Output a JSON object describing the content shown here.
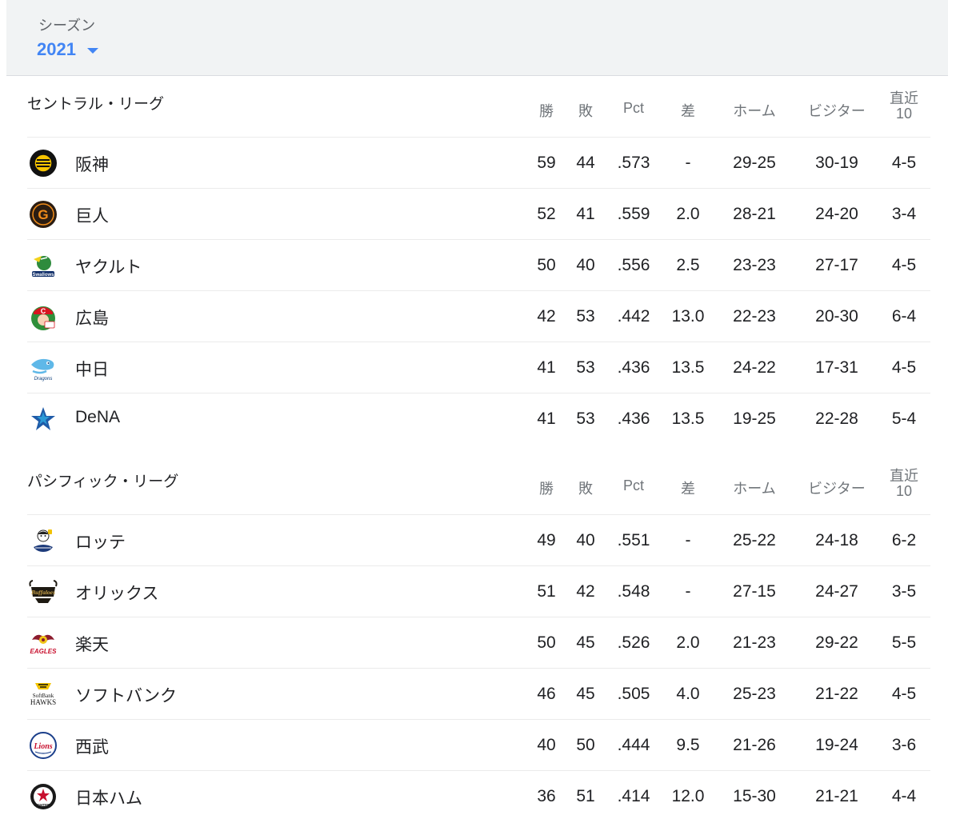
{
  "season": {
    "label": "シーズン",
    "value": "2021"
  },
  "columns": {
    "wins": "勝",
    "losses": "敗",
    "pct": "Pct",
    "gb": "差",
    "home": "ホーム",
    "visitor": "ビジター",
    "last10_line1": "直近",
    "last10_line2": "10"
  },
  "leagues": [
    {
      "name": "セントラル・リーグ",
      "teams": [
        {
          "name": "阪神",
          "logo": "tigers-logo",
          "w": "59",
          "l": "44",
          "pct": ".573",
          "gb": "-",
          "home": "29-25",
          "away": "30-19",
          "last10": "4-5"
        },
        {
          "name": "巨人",
          "logo": "giants-logo",
          "w": "52",
          "l": "41",
          "pct": ".559",
          "gb": "2.0",
          "home": "28-21",
          "away": "24-20",
          "last10": "3-4"
        },
        {
          "name": "ヤクルト",
          "logo": "swallows-logo",
          "w": "50",
          "l": "40",
          "pct": ".556",
          "gb": "2.5",
          "home": "23-23",
          "away": "27-17",
          "last10": "4-5"
        },
        {
          "name": "広島",
          "logo": "carp-logo",
          "w": "42",
          "l": "53",
          "pct": ".442",
          "gb": "13.0",
          "home": "22-23",
          "away": "20-30",
          "last10": "6-4"
        },
        {
          "name": "中日",
          "logo": "dragons-logo",
          "w": "41",
          "l": "53",
          "pct": ".436",
          "gb": "13.5",
          "home": "24-22",
          "away": "17-31",
          "last10": "4-5"
        },
        {
          "name": "DeNA",
          "logo": "baystars-logo",
          "w": "41",
          "l": "53",
          "pct": ".436",
          "gb": "13.5",
          "home": "19-25",
          "away": "22-28",
          "last10": "5-4"
        }
      ]
    },
    {
      "name": "パシフィック・リーグ",
      "teams": [
        {
          "name": "ロッテ",
          "logo": "marines-logo",
          "w": "49",
          "l": "40",
          "pct": ".551",
          "gb": "-",
          "home": "25-22",
          "away": "24-18",
          "last10": "6-2"
        },
        {
          "name": "オリックス",
          "logo": "buffaloes-logo",
          "w": "51",
          "l": "42",
          "pct": ".548",
          "gb": "-",
          "home": "27-15",
          "away": "24-27",
          "last10": "3-5"
        },
        {
          "name": "楽天",
          "logo": "eagles-logo",
          "w": "50",
          "l": "45",
          "pct": ".526",
          "gb": "2.0",
          "home": "21-23",
          "away": "29-22",
          "last10": "5-5"
        },
        {
          "name": "ソフトバンク",
          "logo": "hawks-logo",
          "w": "46",
          "l": "45",
          "pct": ".505",
          "gb": "4.0",
          "home": "25-23",
          "away": "21-22",
          "last10": "4-5"
        },
        {
          "name": "西武",
          "logo": "lions-logo",
          "w": "40",
          "l": "50",
          "pct": ".444",
          "gb": "9.5",
          "home": "21-26",
          "away": "19-24",
          "last10": "3-6"
        },
        {
          "name": "日本ハム",
          "logo": "fighters-logo",
          "w": "36",
          "l": "51",
          "pct": ".414",
          "gb": "12.0",
          "home": "15-30",
          "away": "21-21",
          "last10": "4-4"
        }
      ]
    }
  ],
  "logo_text": {
    "giants": "G",
    "swallows": "Swallows",
    "carp": "C",
    "dragons": "Dragons",
    "buffaloes": "Buffaloes",
    "eagles": "EAGLES",
    "hawks": [
      "SoftBank",
      "HAWKS"
    ],
    "lions": "Lions",
    "fighters": "FIGHTERS"
  },
  "colors": {
    "accent": "#4285f4",
    "header_bg": "#f1f3f4",
    "muted_text": "#70757a",
    "divider": "#ebebeb"
  }
}
